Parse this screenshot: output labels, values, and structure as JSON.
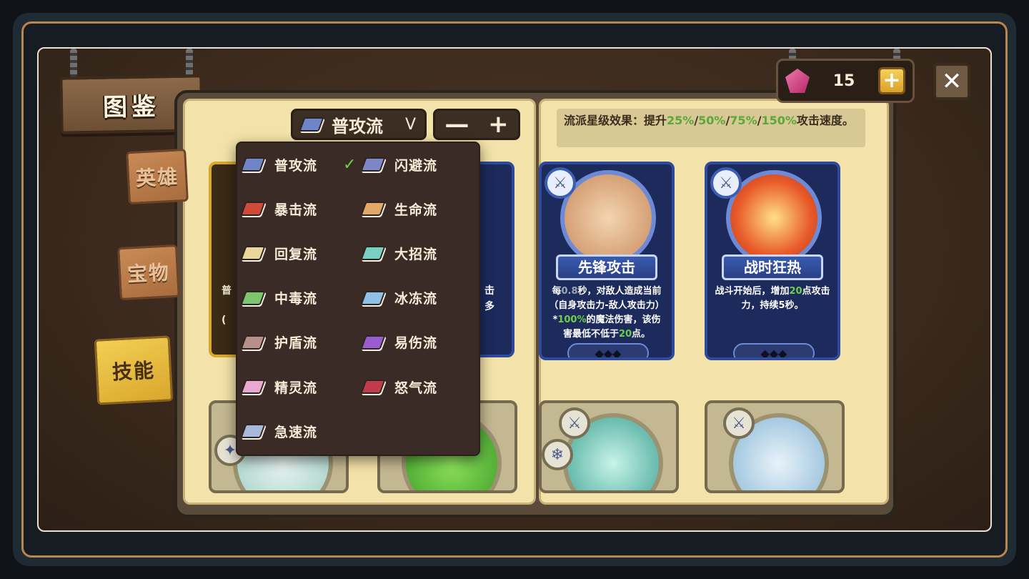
{
  "title": "图鉴",
  "side_tabs": [
    {
      "label": "英雄"
    },
    {
      "label": "宝物"
    },
    {
      "label": "技能"
    }
  ],
  "currency": {
    "count": "15",
    "plus_label": "+"
  },
  "close_label": "✕",
  "style_select": {
    "selected": "普攻流",
    "chevron": "V"
  },
  "stepper": {
    "minus": "—",
    "plus": "+"
  },
  "effect_note": {
    "prefix": "流派星级效果：提升",
    "v1": "25%",
    "v2": "50%",
    "v3": "75%",
    "v4": "150%",
    "suffix": "攻击速度。",
    "sep": "/"
  },
  "dropdown": {
    "check": "✓",
    "options": [
      {
        "label": "普攻流",
        "color": "#6e86c8"
      },
      {
        "label": "闪避流",
        "color": "#7f86c8"
      },
      {
        "label": "暴击流",
        "color": "#d04a3a"
      },
      {
        "label": "生命流",
        "color": "#e1a86a"
      },
      {
        "label": "回复流",
        "color": "#ead79a"
      },
      {
        "label": "大招流",
        "color": "#7ad0c2"
      },
      {
        "label": "中毒流",
        "color": "#7cc46e"
      },
      {
        "label": "冰冻流",
        "color": "#8ec0e8"
      },
      {
        "label": "护盾流",
        "color": "#b88f8a"
      },
      {
        "label": "易伤流",
        "color": "#9a5bd0"
      },
      {
        "label": "精灵流",
        "color": "#e8a8cf"
      },
      {
        "label": "怒气流",
        "color": "#c23b4a"
      },
      {
        "label": "急速流",
        "color": "#a8b8d8"
      }
    ]
  },
  "cards": [
    {
      "name": "先锋攻击",
      "desc_a": "每",
      "desc_b": "0.8",
      "desc_c": "秒，对敌人造成当前（自身攻击力-敌人攻击力）*",
      "desc_d": "100%",
      "desc_e": "的魔法伤害，该伤害最低不低于",
      "desc_f": "20",
      "desc_g": "点。",
      "stars": "◆◆◆"
    },
    {
      "name": "战时狂热",
      "desc_a": "战斗开始后，增加",
      "desc_b": "20",
      "desc_c": "点攻击力，持续5秒。",
      "stars": "◆◆◆"
    }
  ],
  "peek_text": {
    "c1a": "普",
    "c1b": "(",
    "c2a": "击",
    "c2b": "多"
  },
  "icons": {
    "sword": "sword-icon",
    "snowflake": "snowflake-icon",
    "sparkle": "sparkle-icon",
    "check": "check-icon",
    "gem": "gem-icon",
    "close": "close-icon"
  },
  "colors": {
    "accent_green": "#6ed04a",
    "card_blue": "#2f4a9a",
    "gold": "#d9a22c"
  }
}
